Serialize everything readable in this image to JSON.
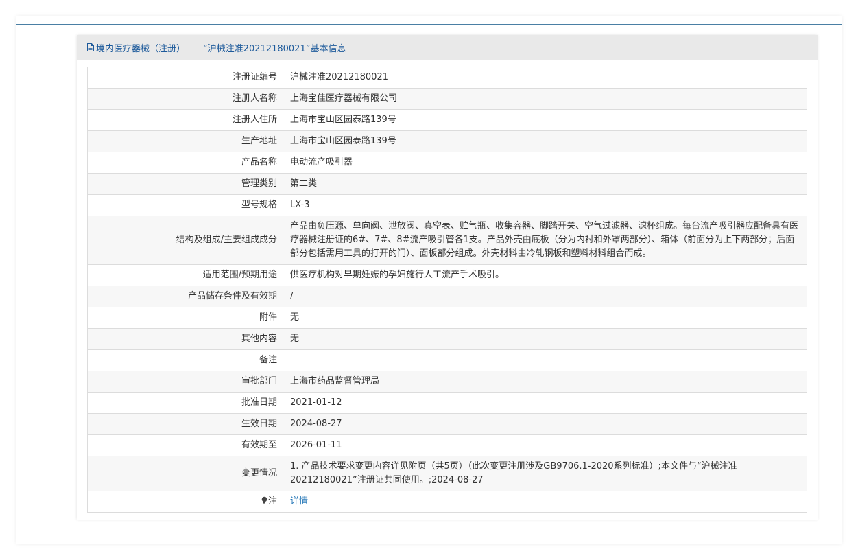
{
  "header": {
    "title": "境内医疗器械（注册）——“沪械注准20212180021”基本信息",
    "icon": "document-icon"
  },
  "colors": {
    "rule": "#4a7fa4",
    "title": "#1d5a9b",
    "link": "#2a7ab9",
    "header_bg": "#e9e9e9"
  },
  "rows": [
    {
      "label": "注册证编号",
      "value": "沪械注准20212180021"
    },
    {
      "label": "注册人名称",
      "value": "上海宝佳医疗器械有限公司"
    },
    {
      "label": "注册人住所",
      "value": "上海市宝山区园泰路139号"
    },
    {
      "label": "生产地址",
      "value": "上海市宝山区园泰路139号"
    },
    {
      "label": "产品名称",
      "value": "电动流产吸引器"
    },
    {
      "label": "管理类别",
      "value": "第二类"
    },
    {
      "label": "型号规格",
      "value": "LX-3"
    },
    {
      "label": "结构及组成/主要组成成分",
      "value": "产品由负压源、单向阀、泄放阀、真空表、贮气瓶、收集容器、脚踏开关、空气过滤器、滤杯组成。每台流产吸引器应配备具有医疗器械注册证的6#、7#、8#流产吸引管各1支。产品外壳由底板（分为内衬和外罩两部分）、箱体（前面分为上下两部分；后面部分包括需用工具的打开的门）、面板部分组成。外壳材料由冷轧钢板和塑料材料组合而成。"
    },
    {
      "label": "适用范围/预期用途",
      "value": "供医疗机构对早期妊娠的孕妇施行人工流产手术吸引。"
    },
    {
      "label": "产品储存条件及有效期",
      "value": "/"
    },
    {
      "label": "附件",
      "value": "无"
    },
    {
      "label": "其他内容",
      "value": "无"
    },
    {
      "label": "备注",
      "value": ""
    },
    {
      "label": "审批部门",
      "value": "上海市药品监督管理局"
    },
    {
      "label": "批准日期",
      "value": "2021-01-12"
    },
    {
      "label": "生效日期",
      "value": "2024-08-27"
    },
    {
      "label": "有效期至",
      "value": "2026-01-11"
    },
    {
      "label": "变更情况",
      "value": "1. 产品技术要求变更内容详见附页（共5页）（此次变更注册涉及GB9706.1-2020系列标准）;本文件与“沪械注准20212180021”注册证共同使用。;2024-08-27"
    }
  ],
  "note": {
    "label": "注",
    "icon": "lightbulb-icon",
    "link_text": "详情"
  }
}
